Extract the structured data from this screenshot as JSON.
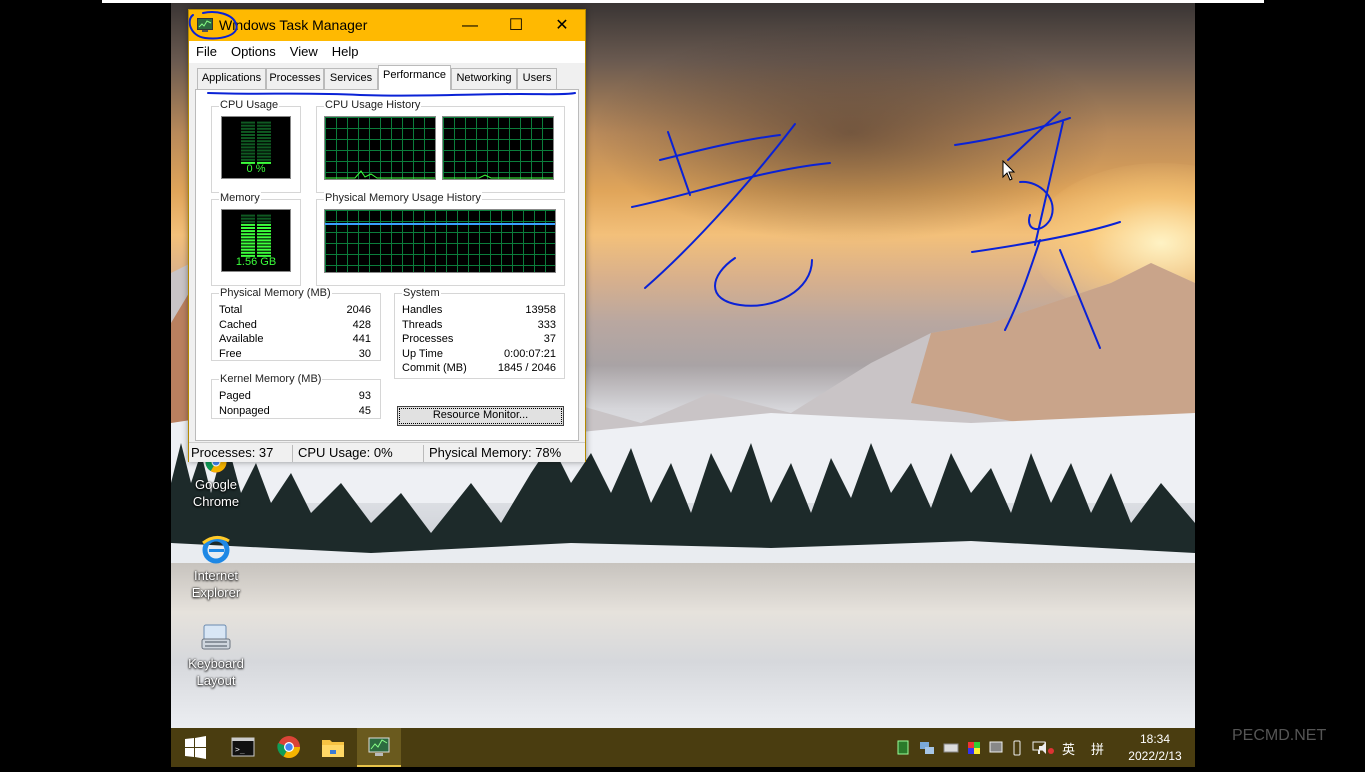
{
  "window": {
    "title": "Windows Task Manager",
    "controls": {
      "minimize": "—",
      "maximize": "☐",
      "close": "✕"
    },
    "menu": [
      "File",
      "Options",
      "View",
      "Help"
    ],
    "tabs": [
      "Applications",
      "Processes",
      "Services",
      "Performance",
      "Networking",
      "Users"
    ],
    "active_tab": "Performance"
  },
  "performance": {
    "cpu_usage_label": "CPU Usage",
    "cpu_usage_value": "0 %",
    "cpu_history_label": "CPU Usage History",
    "memory_label": "Memory",
    "memory_value": "1.56 GB",
    "memory_history_label": "Physical Memory Usage History",
    "cpu_usage_fraction": 0.0,
    "memory_usage_fraction": 0.78
  },
  "physical_memory": {
    "label": "Physical Memory (MB)",
    "rows": [
      {
        "key": "Total",
        "value": "2046"
      },
      {
        "key": "Cached",
        "value": "428"
      },
      {
        "key": "Available",
        "value": "441"
      },
      {
        "key": "Free",
        "value": "30"
      }
    ]
  },
  "kernel_memory": {
    "label": "Kernel Memory (MB)",
    "rows": [
      {
        "key": "Paged",
        "value": "93"
      },
      {
        "key": "Nonpaged",
        "value": "45"
      }
    ]
  },
  "system": {
    "label": "System",
    "rows": [
      {
        "key": "Handles",
        "value": "13958"
      },
      {
        "key": "Threads",
        "value": "333"
      },
      {
        "key": "Processes",
        "value": "37"
      },
      {
        "key": "Up Time",
        "value": "0:00:07:21"
      },
      {
        "key": "Commit (MB)",
        "value": "1845 / 2046"
      }
    ]
  },
  "resource_monitor_button": "Resource Monitor...",
  "statusbar": {
    "processes": "Processes: 37",
    "cpu": "CPU Usage: 0%",
    "memory": "Physical Memory: 78%"
  },
  "desktop_icons": [
    {
      "label_line1": "Google",
      "label_line2": "Chrome",
      "icon": "chrome-icon"
    },
    {
      "label_line1": "Internet",
      "label_line2": "Explorer",
      "icon": "ie-icon"
    },
    {
      "label_line1": "Keyboard",
      "label_line2": "Layout",
      "icon": "keyboard-icon"
    }
  ],
  "taskbar": {
    "items": [
      "start-icon",
      "cmd-icon",
      "chrome-icon",
      "explorer-icon",
      "taskmanager-icon"
    ],
    "tray_ime": "英",
    "tray_input": "拼",
    "time": "18:34",
    "date": "2022/2/13"
  },
  "watermark": "PECMD.NET",
  "colors": {
    "titlebar": "#ffb901",
    "graph_line": "#3cff3c",
    "grid": "#0b7d3b",
    "taskbar": "#4a3d10",
    "ink": "#0a22d6"
  }
}
